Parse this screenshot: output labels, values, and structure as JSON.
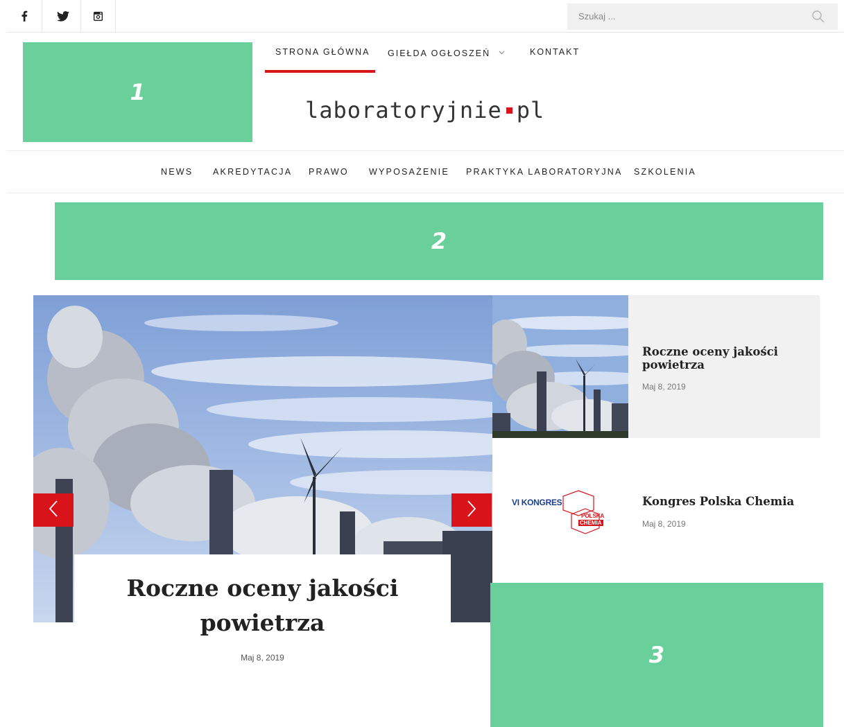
{
  "social": [
    {
      "icon": "facebook-icon"
    },
    {
      "icon": "twitter-icon"
    },
    {
      "icon": "instagram-icon"
    }
  ],
  "search": {
    "placeholder": "Szukaj ..."
  },
  "ads": [
    {
      "label": "1"
    },
    {
      "label": "2"
    },
    {
      "label": "3"
    }
  ],
  "top_nav": [
    {
      "label": "STRONA GŁÓWNA",
      "active": true
    },
    {
      "label": "GIEŁDA OGŁOSZEŃ",
      "dropdown": true
    },
    {
      "label": "KONTAKT"
    }
  ],
  "logo": {
    "left": "laboratoryjnie",
    "right": "pl"
  },
  "categories": [
    {
      "label": "NEWS"
    },
    {
      "label": "AKREDYTACJA"
    },
    {
      "label": "PRAWO"
    },
    {
      "label": "WYPOSAŻENIE"
    },
    {
      "label": "PRAKTYKA LABORATORYJNA"
    },
    {
      "label": "SZKOLENIA"
    }
  ],
  "slider": {
    "title": "Roczne oceny jakości powietrza",
    "date": "Maj 8, 2019"
  },
  "posts": [
    {
      "title": "Roczne oceny jakości powietrza",
      "date": "Maj 8, 2019"
    },
    {
      "title": "Kongres Polska Chemia",
      "date": "Maj 8, 2019",
      "logo_text_1": "VI KONGRES",
      "logo_text_2": "POLSKA",
      "logo_text_3": "CHEMIA"
    }
  ],
  "colors": {
    "accent": "#d8141a",
    "promo": "#6ad09b"
  }
}
